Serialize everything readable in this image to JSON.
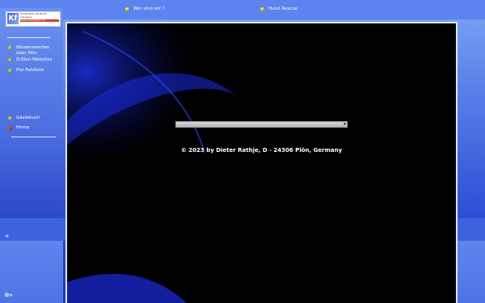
{
  "header": {
    "nav": [
      {
        "label": "Wer sind wir ?",
        "icon": "yellow-bullet-icon"
      },
      {
        "label": "Hund Rescue",
        "icon": "yellow-bullet-icon"
      }
    ]
  },
  "sidebar": {
    "logo": {
      "mark": "Kf",
      "lines": [
        "Kinderleben als Recht",
        "auf Leben",
        "www.kinderleben.de"
      ]
    },
    "items": [
      {
        "label": "Wissenswertes über Plön",
        "icon": "green-bullet-icon"
      },
      {
        "label": "D-Elen-Websites",
        "icon": "green-bullet-icon"
      },
      {
        "label": "Pixi-Fehlliste",
        "icon": "green-bullet-icon"
      }
    ],
    "lower_items": [
      {
        "label": "Gästebuch",
        "icon": "green-bullet-icon"
      },
      {
        "label": "Home",
        "icon": "red-bullet-icon"
      }
    ]
  },
  "main": {
    "progress": {
      "value_percent": 100,
      "handle_symbol": "▾"
    },
    "copyright": "© 2023 by Dieter Rathje, D - 24306 Plön, Germany"
  },
  "footer": {
    "back_arrow": "<",
    "forward_arrow": "D>"
  },
  "colors": {
    "panel_background": "#000000",
    "frame_blue": "#3d62dd",
    "bullet_yellow": "#f1e24a",
    "bullet_green": "#b7cf43",
    "bullet_red": "#e04a2a"
  }
}
